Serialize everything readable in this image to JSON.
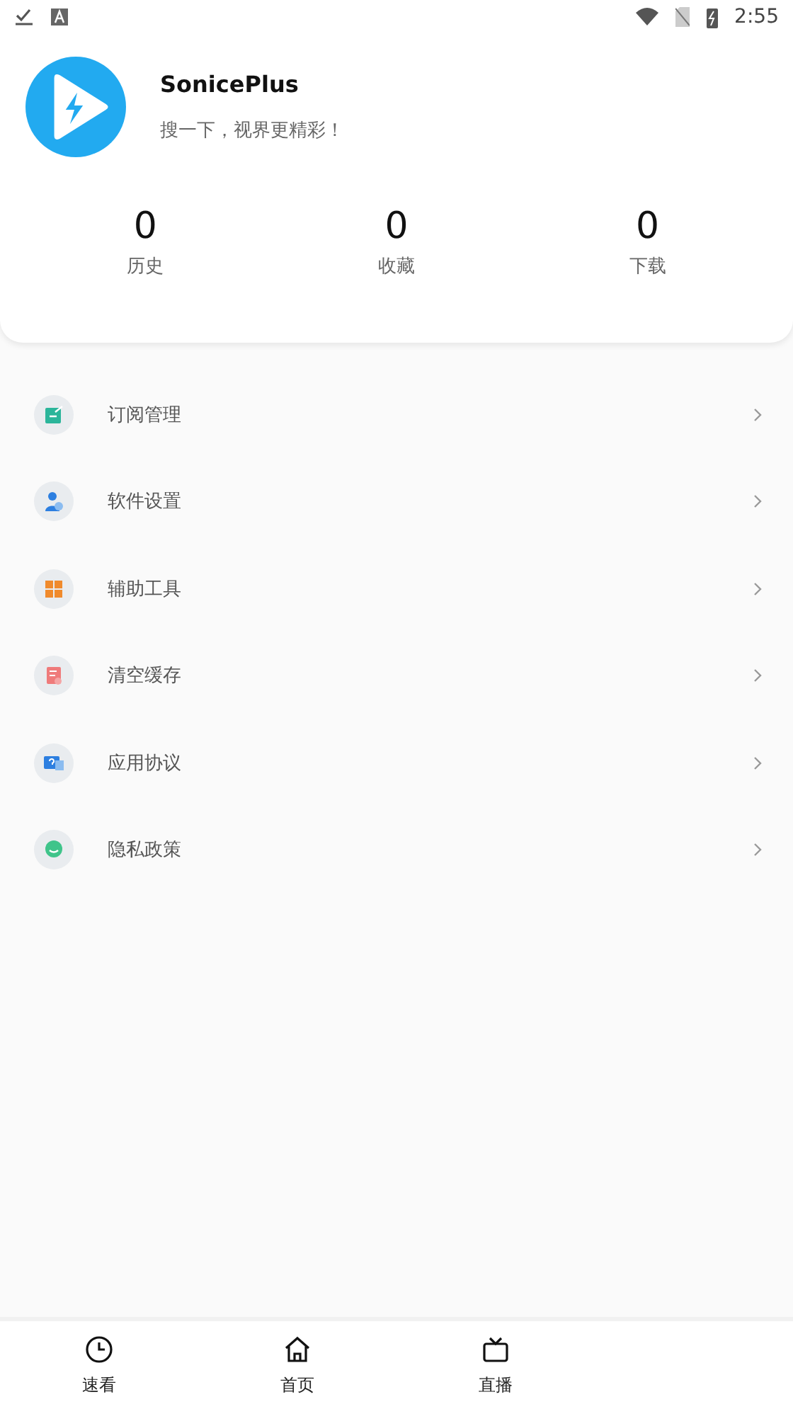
{
  "status_bar": {
    "time": "2:55"
  },
  "profile": {
    "name": "SonicePlus",
    "slogan": "搜一下，视界更精彩！"
  },
  "stats": [
    {
      "value": "0",
      "label": "历史"
    },
    {
      "value": "0",
      "label": "收藏"
    },
    {
      "value": "0",
      "label": "下载"
    }
  ],
  "menu": [
    {
      "kind": "subscribe",
      "label": "订阅管理"
    },
    {
      "kind": "settings",
      "label": "软件设置"
    },
    {
      "kind": "tools",
      "label": "辅助工具"
    },
    {
      "kind": "cache",
      "label": "清空缓存"
    },
    {
      "kind": "agreement",
      "label": "应用协议"
    },
    {
      "kind": "privacy",
      "label": "隐私政策"
    }
  ],
  "bottom_nav": [
    {
      "kind": "clock",
      "label": "速看"
    },
    {
      "kind": "home",
      "label": "首页"
    },
    {
      "kind": "tv",
      "label": "直播"
    }
  ]
}
